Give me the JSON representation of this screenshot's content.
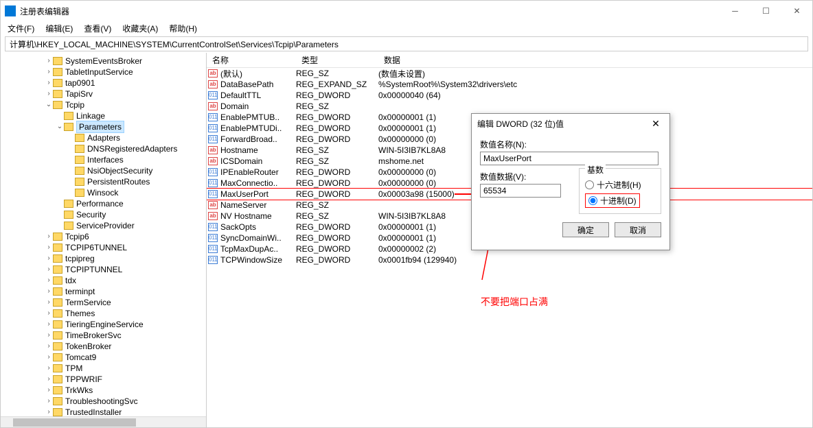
{
  "title": "注册表编辑器",
  "menu": [
    "文件(F)",
    "编辑(E)",
    "查看(V)",
    "收藏夹(A)",
    "帮助(H)"
  ],
  "address": "计算机\\HKEY_LOCAL_MACHINE\\SYSTEM\\CurrentControlSet\\Services\\Tcpip\\Parameters",
  "tree": [
    {
      "d": 4,
      "t": ">",
      "n": "SystemEventsBroker"
    },
    {
      "d": 4,
      "t": ">",
      "n": "TabletInputService"
    },
    {
      "d": 4,
      "t": ">",
      "n": "tap0901"
    },
    {
      "d": 4,
      "t": ">",
      "n": "TapiSrv"
    },
    {
      "d": 4,
      "t": "v",
      "n": "Tcpip"
    },
    {
      "d": 5,
      "t": "",
      "n": "Linkage"
    },
    {
      "d": 5,
      "t": "v",
      "n": "Parameters",
      "sel": true
    },
    {
      "d": 6,
      "t": "",
      "n": "Adapters"
    },
    {
      "d": 6,
      "t": "",
      "n": "DNSRegisteredAdapters"
    },
    {
      "d": 6,
      "t": "",
      "n": "Interfaces"
    },
    {
      "d": 6,
      "t": "",
      "n": "NsiObjectSecurity"
    },
    {
      "d": 6,
      "t": "",
      "n": "PersistentRoutes"
    },
    {
      "d": 6,
      "t": "",
      "n": "Winsock"
    },
    {
      "d": 5,
      "t": "",
      "n": "Performance"
    },
    {
      "d": 5,
      "t": "",
      "n": "Security"
    },
    {
      "d": 5,
      "t": "",
      "n": "ServiceProvider"
    },
    {
      "d": 4,
      "t": ">",
      "n": "Tcpip6"
    },
    {
      "d": 4,
      "t": ">",
      "n": "TCPIP6TUNNEL"
    },
    {
      "d": 4,
      "t": ">",
      "n": "tcpipreg"
    },
    {
      "d": 4,
      "t": ">",
      "n": "TCPIPTUNNEL"
    },
    {
      "d": 4,
      "t": ">",
      "n": "tdx"
    },
    {
      "d": 4,
      "t": ">",
      "n": "terminpt"
    },
    {
      "d": 4,
      "t": ">",
      "n": "TermService"
    },
    {
      "d": 4,
      "t": ">",
      "n": "Themes"
    },
    {
      "d": 4,
      "t": ">",
      "n": "TieringEngineService"
    },
    {
      "d": 4,
      "t": ">",
      "n": "TimeBrokerSvc"
    },
    {
      "d": 4,
      "t": ">",
      "n": "TokenBroker"
    },
    {
      "d": 4,
      "t": ">",
      "n": "Tomcat9"
    },
    {
      "d": 4,
      "t": ">",
      "n": "TPM"
    },
    {
      "d": 4,
      "t": ">",
      "n": "TPPWRIF"
    },
    {
      "d": 4,
      "t": ">",
      "n": "TrkWks"
    },
    {
      "d": 4,
      "t": ">",
      "n": "TroubleshootingSvc"
    },
    {
      "d": 4,
      "t": ">",
      "n": "TrustedInstaller"
    }
  ],
  "columns": {
    "name": "名称",
    "type": "类型",
    "data": "数据"
  },
  "rows": [
    {
      "ic": "ab",
      "n": "(默认)",
      "t": "REG_SZ",
      "d": "(数值未设置)"
    },
    {
      "ic": "ab",
      "n": "DataBasePath",
      "t": "REG_EXPAND_SZ",
      "d": "%SystemRoot%\\System32\\drivers\\etc"
    },
    {
      "ic": "nm",
      "n": "DefaultTTL",
      "t": "REG_DWORD",
      "d": "0x00000040 (64)"
    },
    {
      "ic": "ab",
      "n": "Domain",
      "t": "REG_SZ",
      "d": ""
    },
    {
      "ic": "nm",
      "n": "EnablePMTUB..",
      "t": "REG_DWORD",
      "d": "0x00000001 (1)"
    },
    {
      "ic": "nm",
      "n": "EnablePMTUDi..",
      "t": "REG_DWORD",
      "d": "0x00000001 (1)"
    },
    {
      "ic": "nm",
      "n": "ForwardBroad..",
      "t": "REG_DWORD",
      "d": "0x00000000 (0)"
    },
    {
      "ic": "ab",
      "n": "Hostname",
      "t": "REG_SZ",
      "d": "WIN-5I3IB7KL8A8"
    },
    {
      "ic": "ab",
      "n": "ICSDomain",
      "t": "REG_SZ",
      "d": "mshome.net"
    },
    {
      "ic": "nm",
      "n": "IPEnableRouter",
      "t": "REG_DWORD",
      "d": "0x00000000 (0)"
    },
    {
      "ic": "nm",
      "n": "MaxConnectio..",
      "t": "REG_DWORD",
      "d": "0x00000000 (0)"
    },
    {
      "ic": "nm",
      "n": "MaxUserPort",
      "t": "REG_DWORD",
      "d": "0x00003a98 (15000)",
      "hl": true
    },
    {
      "ic": "ab",
      "n": "NameServer",
      "t": "REG_SZ",
      "d": ""
    },
    {
      "ic": "ab",
      "n": "NV Hostname",
      "t": "REG_SZ",
      "d": "WIN-5I3IB7KL8A8"
    },
    {
      "ic": "nm",
      "n": "SackOpts",
      "t": "REG_DWORD",
      "d": "0x00000001 (1)"
    },
    {
      "ic": "nm",
      "n": "SyncDomainWi..",
      "t": "REG_DWORD",
      "d": "0x00000001 (1)"
    },
    {
      "ic": "nm",
      "n": "TcpMaxDupAc..",
      "t": "REG_DWORD",
      "d": "0x00000002 (2)"
    },
    {
      "ic": "nm",
      "n": "TCPWindowSize",
      "t": "REG_DWORD",
      "d": "0x0001fb94 (129940)"
    }
  ],
  "dialog": {
    "title": "编辑 DWORD (32 位)值",
    "name_label": "数值名称(N):",
    "name_value": "MaxUserPort",
    "data_label": "数值数据(V):",
    "data_value": "65534",
    "base_label": "基数",
    "hex_label": "十六进制(H)",
    "dec_label": "十进制(D)",
    "ok": "确定",
    "cancel": "取消"
  },
  "note": "不要把端口占满"
}
